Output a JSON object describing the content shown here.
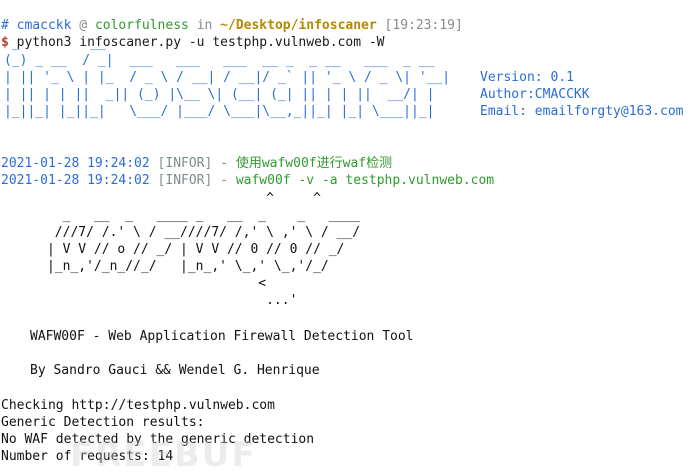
{
  "prompt": {
    "hash": "#",
    "user": "cmacckk",
    "at": "@",
    "host": "colorfulness",
    "in": "in",
    "path": "~/Desktop/infoscaner",
    "time": "[19:23:19]"
  },
  "command": {
    "dollar": "$",
    "text": "python3 infoscaner.py -u testphp.vulnweb.com -W"
  },
  "banner": {
    "ascii": " _         __                                                 \n(_) _ __  / _|  ___   ___   ___  __ _  _ __   ___  _ __ \n| || '_ \\ | |_  / _ \\ / __| / __|/ _` || '_ \\ / _ \\| '__|\n| || | | ||  _|| (_) |\\__ \\| (__| (_| || | | ||  __/| |   \n|_||_| |_||_|   \\___/ |___/ \\___|\\__,_||_| |_| \\___||_|   ",
    "version": "Version: 0.1",
    "author": "Author:CMACCKK",
    "email": "Email: emailforgty@163.com"
  },
  "logs": [
    {
      "timestamp": "2021-01-28 19:24:02",
      "level": "[INFOR]",
      "dash": "-",
      "message": "使用wafw00f进行waf检测"
    },
    {
      "timestamp": "2021-01-28 19:24:02",
      "level": "[INFOR]",
      "dash": "-",
      "message": "wafw00f -v -a testphp.vulnweb.com"
    }
  ],
  "wafw00f_art": "                                  ^     ^\n        _   __  _   ____ _   __  _    _   ____\n       ///7/ /.' \\ / __////7/ /,' \\ ,' \\ / __/\n      | V V // o // _/ | V V // 0 // 0 // _/\n      |_n_,'/_n_//_/   |_n_,' \\_,' \\_,'/_/\n                                 <\n                                  ...'",
  "tool_title": "WAFW00F - Web Application Firewall Detection Tool",
  "authors": "By Sandro Gauci && Wendel G. Henrique",
  "results": [
    "Checking http://testphp.vulnweb.com",
    "Generic Detection results:",
    "No WAF detected by the generic detection",
    "Number of requests: 14"
  ],
  "watermark": "FREEBUF"
}
